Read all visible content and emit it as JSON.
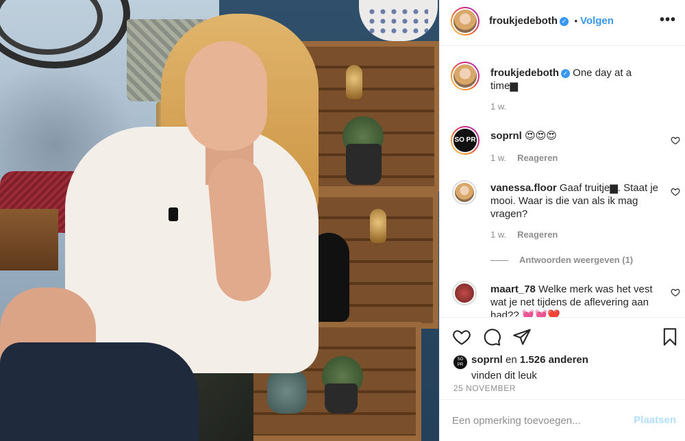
{
  "post": {
    "author": "froukjedeboth",
    "follow_label": "Volgen",
    "separator": "•",
    "more_label": "•••"
  },
  "caption": {
    "username": "froukjedeboth",
    "text": "One day at a time▆",
    "time": "1 w."
  },
  "comments": [
    {
      "username": "soprnl",
      "text": "😍😍😍",
      "time": "1 w.",
      "reply_label": "Reageren",
      "avatar_text": "SO PR"
    },
    {
      "username": "vanessa.floor",
      "text": "Gaaf truitje▆. Staat je mooi. Waar is die van als ik mag vragen?",
      "time": "1 w.",
      "reply_label": "Reageren"
    },
    {
      "username": "maart_78",
      "text": "Welke merk was het vest wat je net tijdens de aflevering aan had?? 💓💓❤️"
    }
  ],
  "view_replies": "Antwoorden weergeven (1)",
  "likes": {
    "user": "soprnl",
    "connector": "en",
    "count_text": "1.526 anderen",
    "suffix": "vinden dit leuk"
  },
  "date": "25 NOVEMBER",
  "comment_box": {
    "placeholder": "Een opmerking toevoegen...",
    "post_label": "Plaatsen"
  },
  "colors": {
    "link": "#3897f0",
    "post_button_disabled": "#b2dffc",
    "secondary_text": "#8e8e8e"
  }
}
